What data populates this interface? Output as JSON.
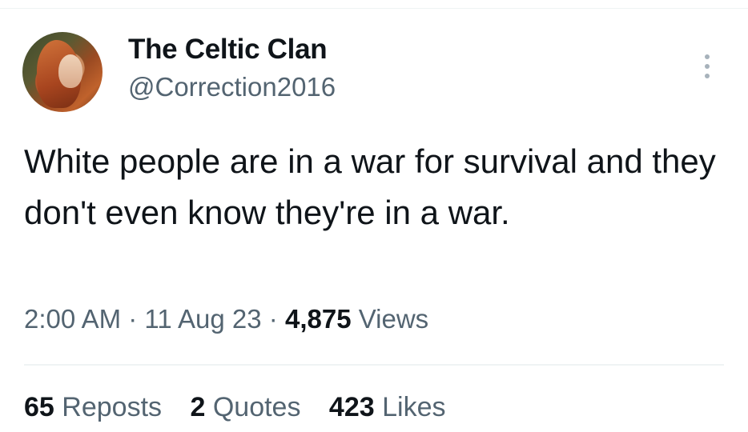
{
  "author": {
    "display_name": "The Celtic Clan",
    "handle": "@Correction2016",
    "avatar_icon": "portrait-avatar"
  },
  "tweet": {
    "text": "White people are in a war for survival and they don't even know they're in a war."
  },
  "meta": {
    "time": "2:00 AM",
    "separator": "·",
    "date": "11 Aug 23",
    "views_count": "4,875",
    "views_label": "Views"
  },
  "stats": {
    "reposts_count": "65",
    "reposts_label": "Reposts",
    "quotes_count": "2",
    "quotes_label": "Quotes",
    "likes_count": "423",
    "likes_label": "Likes"
  },
  "colors": {
    "text_primary": "#0f1419",
    "text_secondary": "#536471",
    "divider": "#eff3f4"
  },
  "icons": {
    "more": "more-options-icon"
  }
}
